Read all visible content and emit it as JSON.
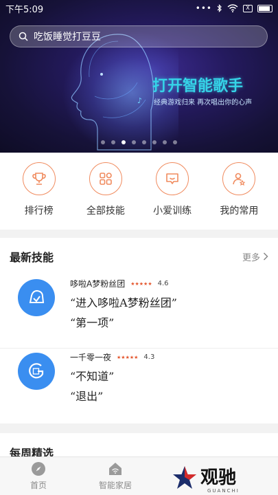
{
  "status": {
    "time": "下午5:09",
    "sim_label": "X"
  },
  "search": {
    "placeholder": "吃饭睡觉打豆豆"
  },
  "banner": {
    "title": "打开智能歌手",
    "subtitle": "经典游戏归来 再次唱出你的心声",
    "page_count": 8,
    "active_page": 3
  },
  "shortcuts": [
    {
      "label": "排行榜",
      "icon": "trophy-icon"
    },
    {
      "label": "全部技能",
      "icon": "grid-icon"
    },
    {
      "label": "小爱训练",
      "icon": "chat-bubble-icon"
    },
    {
      "label": "我的常用",
      "icon": "user-star-icon"
    }
  ],
  "latest": {
    "title": "最新技能",
    "more_label": "更多",
    "skills": [
      {
        "name": "哆啦A梦粉丝团",
        "rating": "4.6",
        "phrases": [
          "“进入哆啦A梦粉丝团”",
          "“第一项”"
        ],
        "icon": "bell-icon"
      },
      {
        "name": "一千零一夜",
        "rating": "4.3",
        "phrases": [
          "“不知道”",
          "“退出”"
        ],
        "icon": "book-icon"
      }
    ]
  },
  "weekly": {
    "title": "每周精选"
  },
  "bottom_nav": [
    {
      "label": "首页",
      "icon": "compass-icon"
    },
    {
      "label": "智能家居",
      "icon": "home-wifi-icon"
    }
  ],
  "watermark": {
    "text": "观驰",
    "small": "GUANCHI"
  },
  "colors": {
    "accent": "#f08a5d",
    "skill_blue": "#3a8ef0",
    "banner_cyan": "#35d4e8"
  }
}
